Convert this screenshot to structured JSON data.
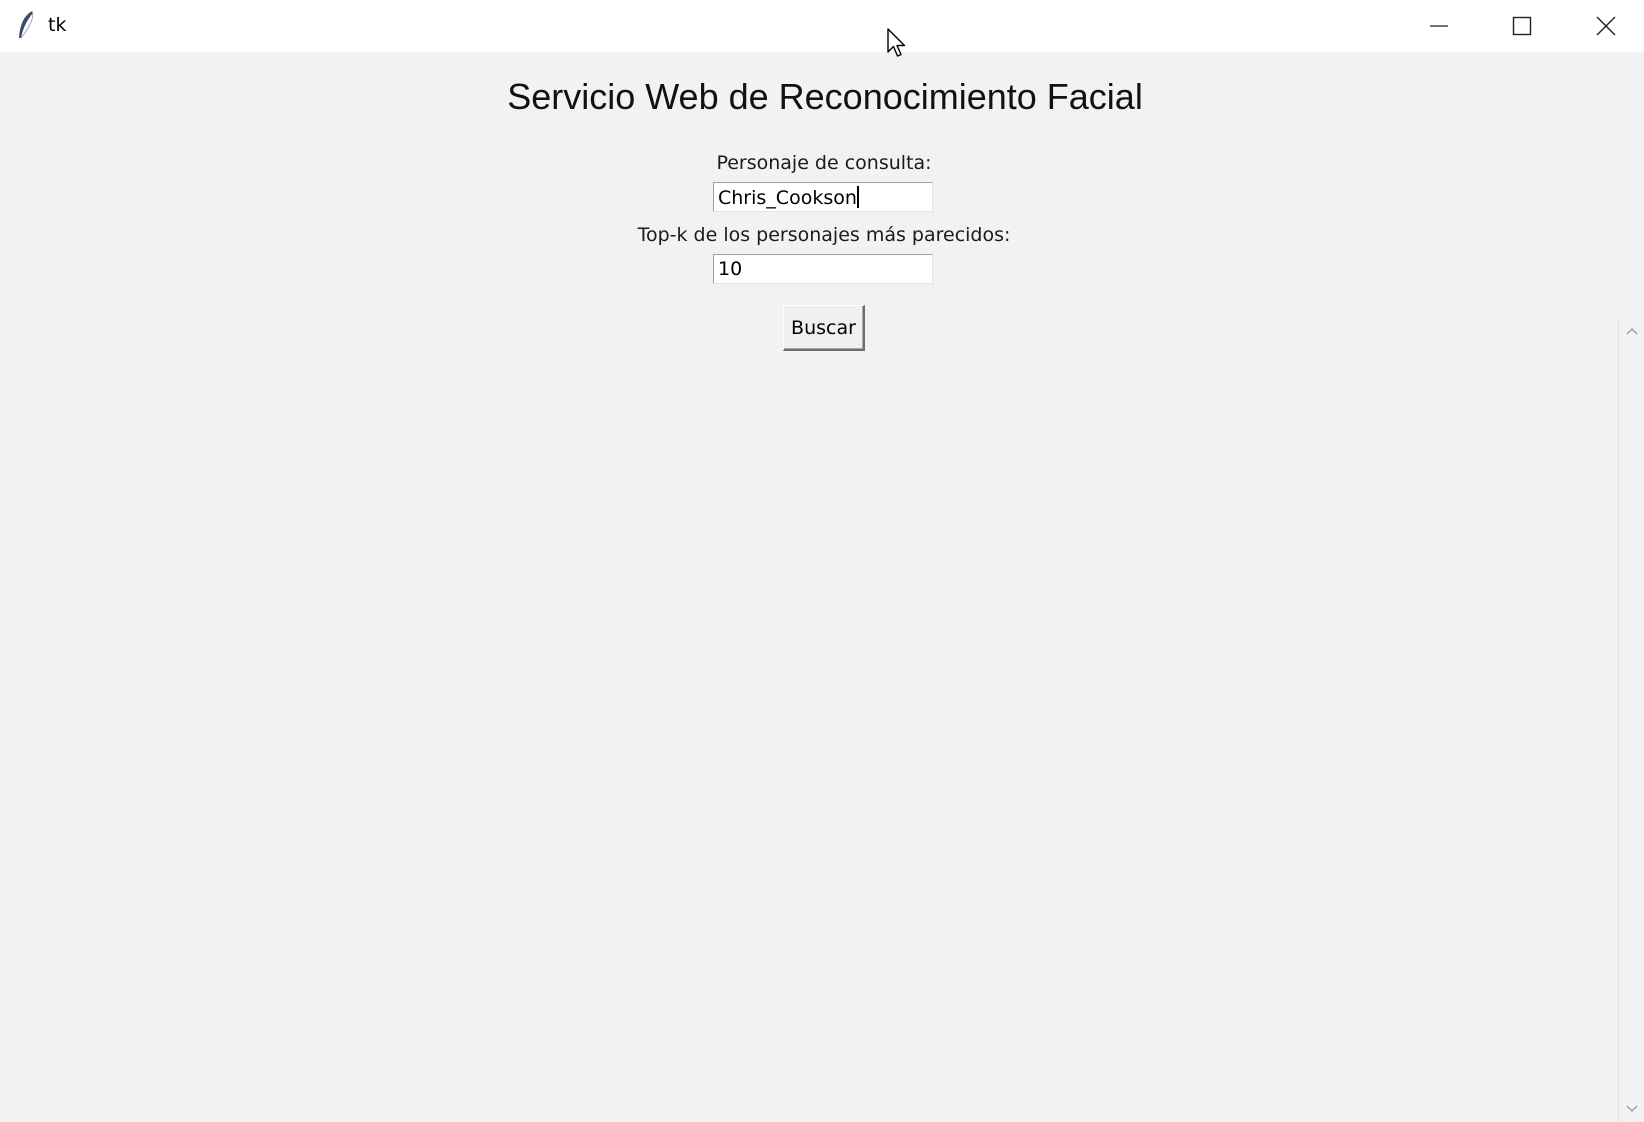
{
  "window": {
    "title": "tk"
  },
  "main": {
    "title": "Servicio Web de Reconocimiento Facial",
    "query_label": "Personaje de consulta:",
    "query_value": "Chris_Cookson",
    "topk_label": "Top-k de los personajes más parecidos:",
    "topk_value": "10",
    "search_button": "Buscar"
  },
  "icons": {
    "app": "feather-icon",
    "minimize": "minimize-icon",
    "maximize": "maximize-icon",
    "close": "close-icon",
    "cursor": "mouse-pointer-icon",
    "scroll_up": "chevron-up-icon",
    "scroll_down": "chevron-down-icon"
  }
}
